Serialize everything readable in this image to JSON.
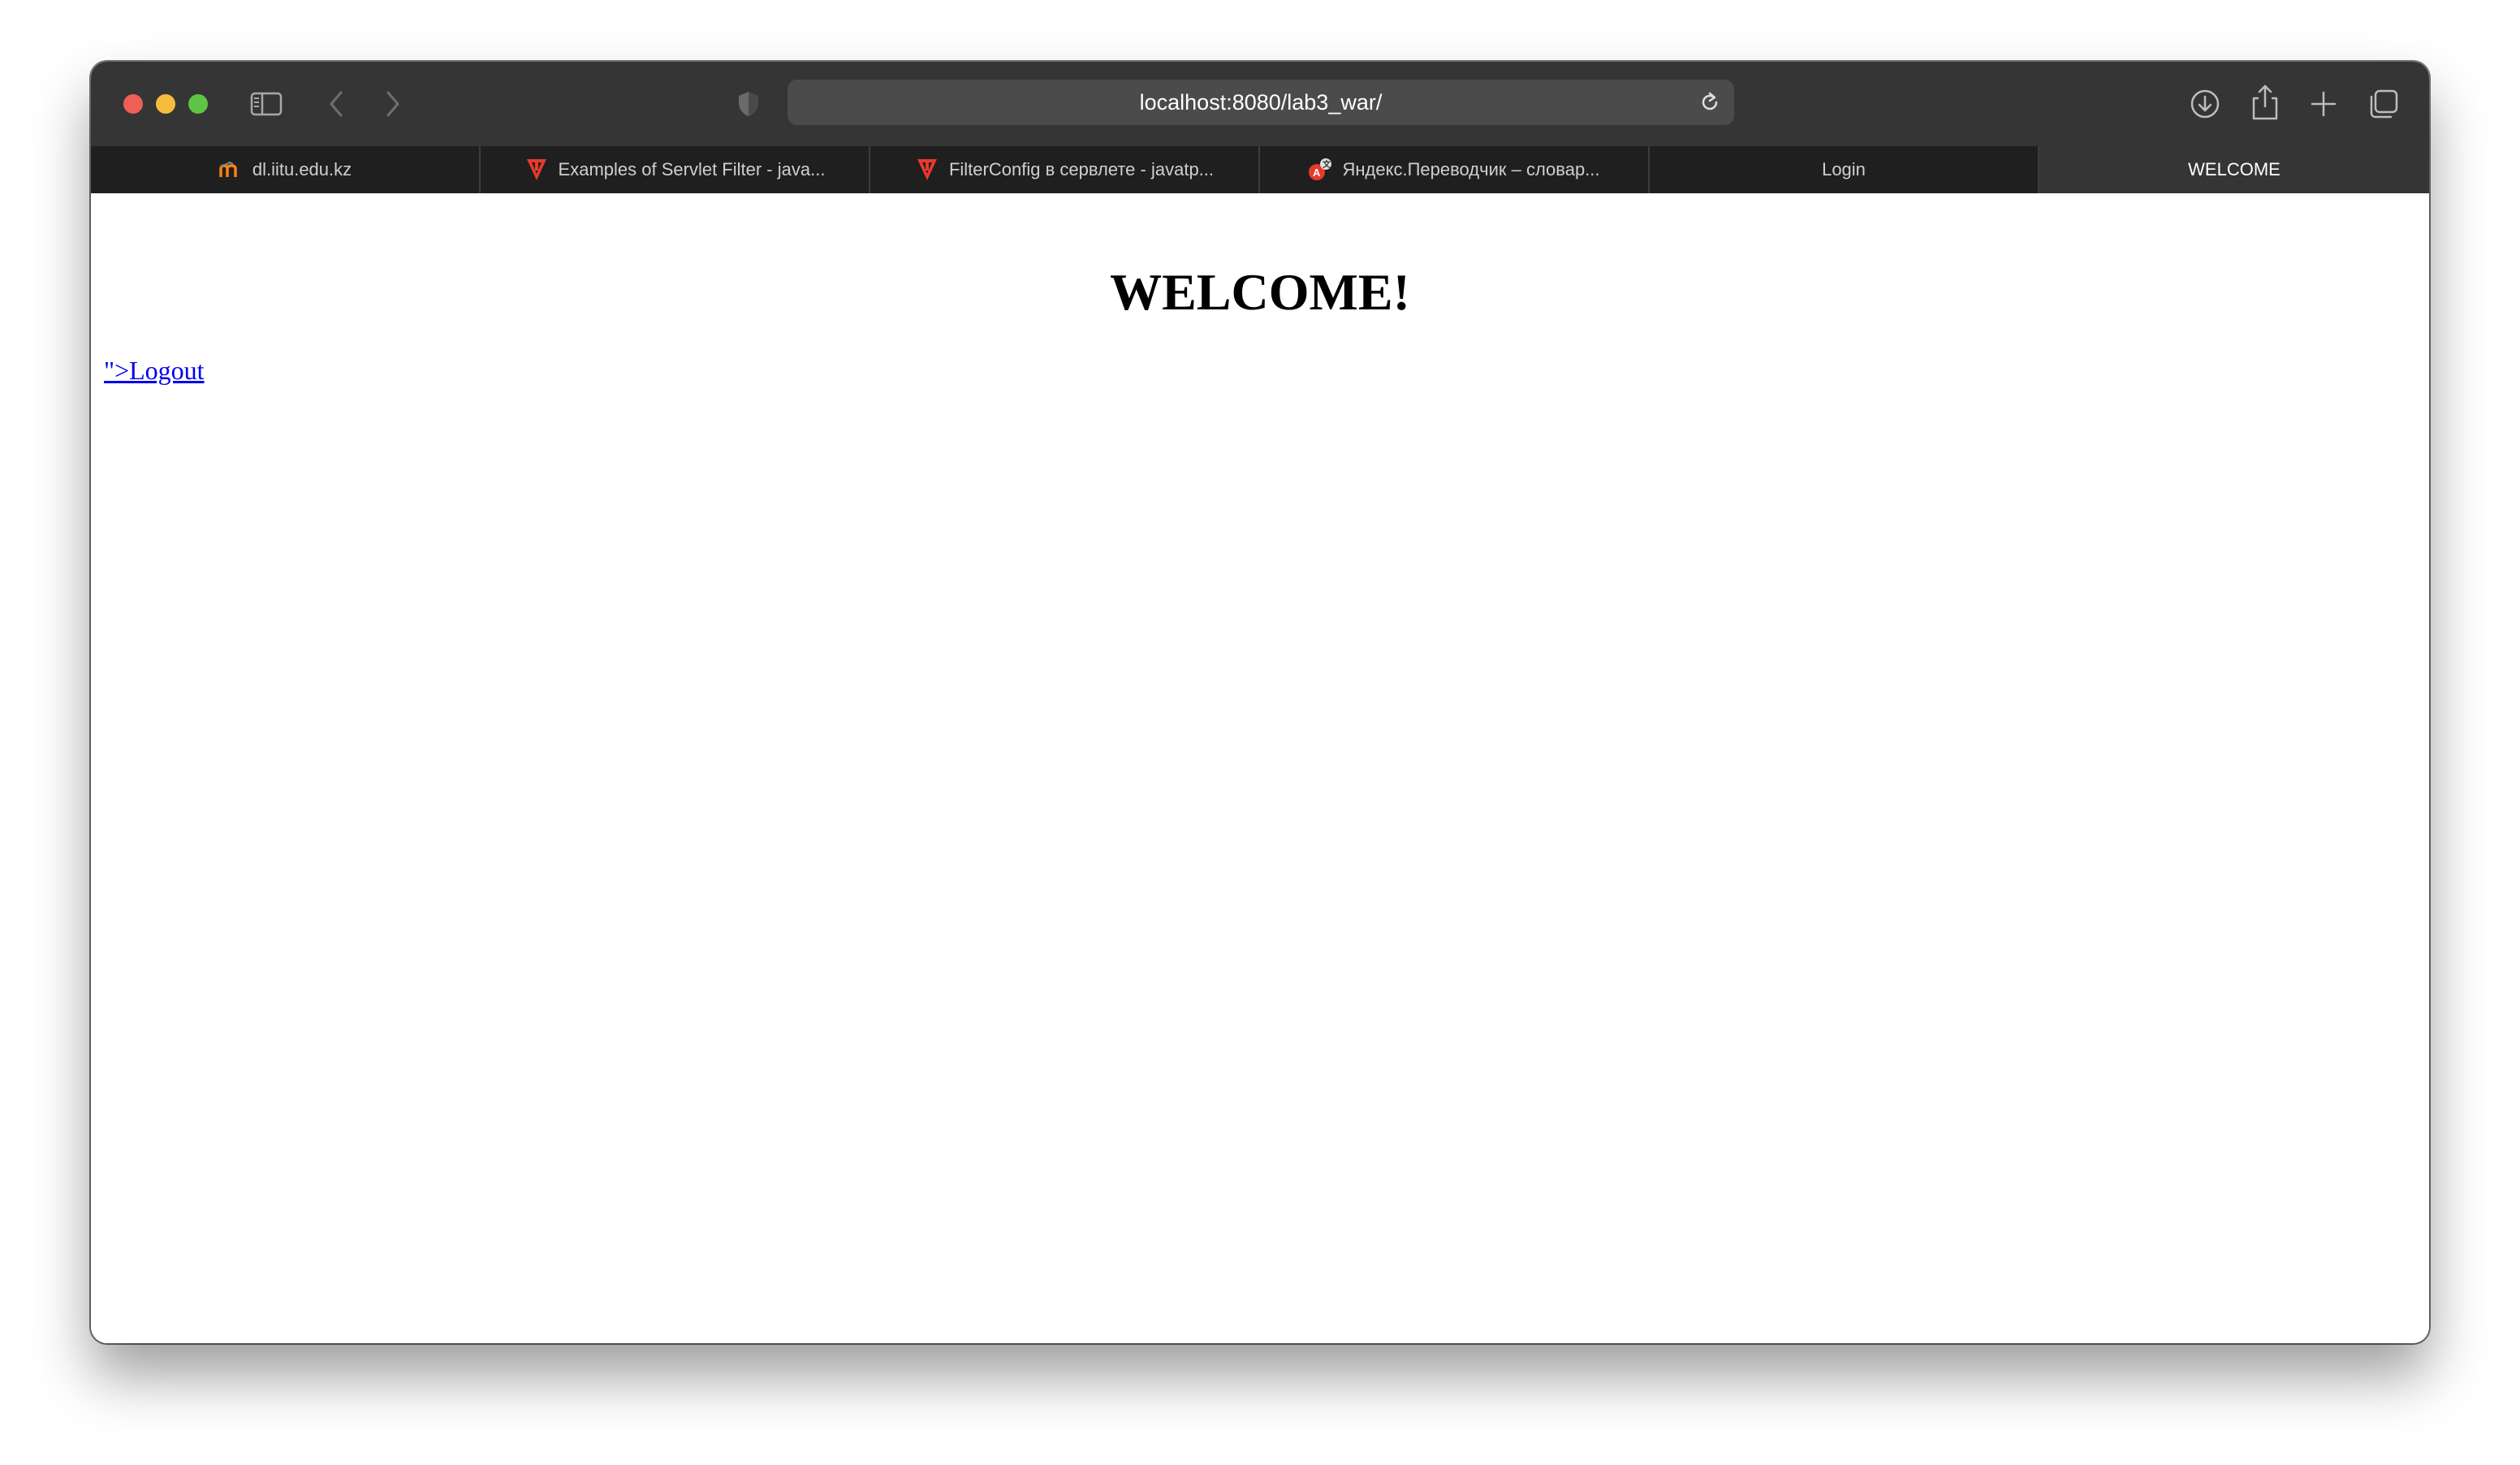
{
  "browser": {
    "address": "localhost:8080/lab3_war/"
  },
  "tabs": [
    {
      "label": "dl.iitu.edu.kz",
      "favicon": "moodle-icon",
      "active": false
    },
    {
      "label": "Examples of Servlet Filter - java...",
      "favicon": "javatpoint-icon",
      "active": false
    },
    {
      "label": "FilterConfig в сервлете - javatp...",
      "favicon": "javatpoint-icon",
      "active": false
    },
    {
      "label": "Яндекс.Переводчик – словар...",
      "favicon": "yandex-translate-icon",
      "active": false
    },
    {
      "label": "Login",
      "favicon": "",
      "active": false
    },
    {
      "label": "WELCOME",
      "favicon": "",
      "active": true
    }
  ],
  "page": {
    "heading": "WELCOME!",
    "logout_link": "\">Logout"
  },
  "colors": {
    "toolbar": "#353535",
    "tabbar": "#1f1f1f",
    "link": "#0000ee",
    "close": "#ee5f57",
    "minimize": "#f6bd3c",
    "maximize": "#5ec544"
  }
}
